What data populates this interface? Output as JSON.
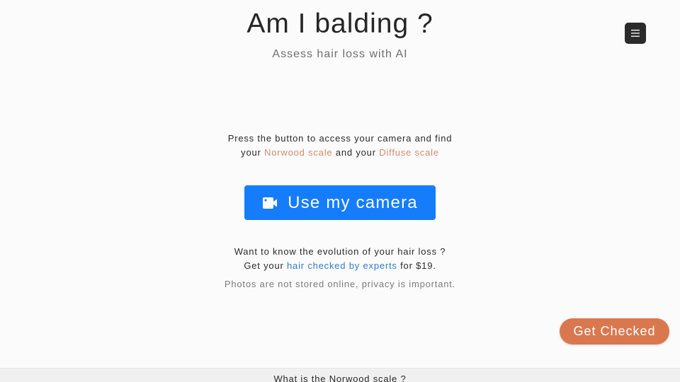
{
  "header": {
    "title": "Am I balding ?",
    "subtitle": "Assess hair loss with AI",
    "menu_icon": "hamburger-menu-icon"
  },
  "intro": {
    "line1": "Press the button to access your camera and find",
    "prefix": "your ",
    "norwood_link": "Norwood scale",
    "middle": " and your ",
    "diffuse_link": "Diffuse scale"
  },
  "camera_button": {
    "label": "Use my camera",
    "icon": "video-camera-icon"
  },
  "evolution": {
    "line1": "Want to know the evolution of your hair loss ?",
    "prefix": "Get your ",
    "link": "hair checked by experts",
    "suffix": " for $19."
  },
  "privacy_note": "Photos are not stored online, privacy is important.",
  "floating_button": {
    "label": "Get Checked"
  },
  "next_section": {
    "title": "What is the Norwood scale ?"
  },
  "colors": {
    "primary_blue": "#157dfb",
    "accent_orange": "#d9784f",
    "link_orange": "#d58a6c",
    "link_blue": "#2f7ccf",
    "menu_dark": "#2b2b2b"
  }
}
